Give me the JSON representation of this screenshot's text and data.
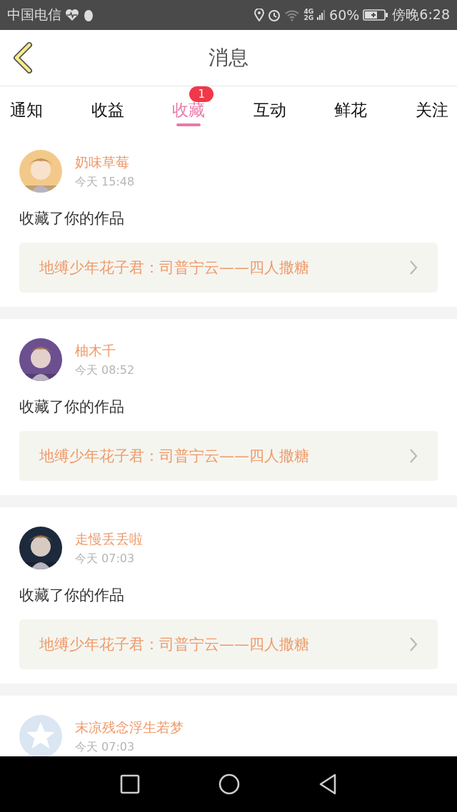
{
  "status_bar": {
    "carrier": "中国电信",
    "network_top": "4G",
    "network_bottom": "2G",
    "battery": "60%",
    "time": "傍晚6:28"
  },
  "header": {
    "title": "消息"
  },
  "tabs": [
    {
      "label": "通知",
      "selected": false
    },
    {
      "label": "收益",
      "selected": false
    },
    {
      "label": "收藏",
      "selected": true,
      "badge": "1"
    },
    {
      "label": "互动",
      "selected": false
    },
    {
      "label": "鲜花",
      "selected": false
    },
    {
      "label": "关注",
      "selected": false
    }
  ],
  "messages": [
    {
      "name": "奶味草莓",
      "time": "今天 15:48",
      "action": "收藏了你的作品",
      "work": "地缚少年花子君：司普宁云——四人撒糖"
    },
    {
      "name": "柚木千",
      "time": "今天 08:52",
      "action": "收藏了你的作品",
      "work": "地缚少年花子君：司普宁云——四人撒糖"
    },
    {
      "name": "走慢丢丢啦",
      "time": "今天 07:03",
      "action": "收藏了你的作品",
      "work": "地缚少年花子君：司普宁云——四人撒糖"
    },
    {
      "avatar": {
        "kind": "icon"
      },
      "name": "末凉残念浮生若梦",
      "time": "今天 07:03"
    }
  ]
}
